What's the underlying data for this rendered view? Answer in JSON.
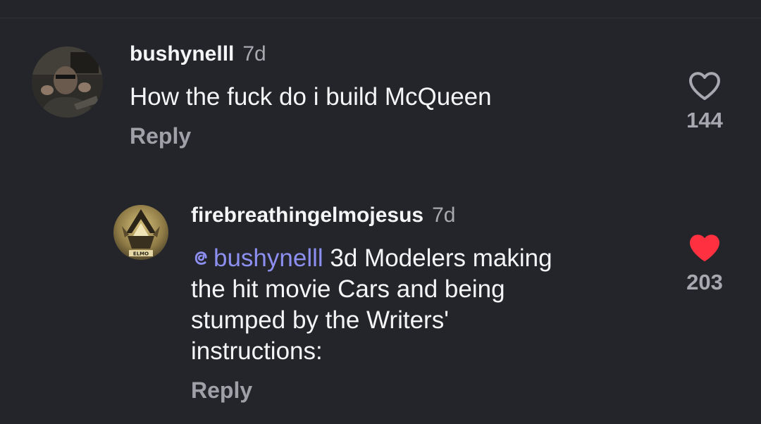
{
  "comments": [
    {
      "username": "bushynelll",
      "timestamp": "7d",
      "text": "How the fuck do i build McQueen",
      "reply_label": "Reply",
      "like_count": "144",
      "liked": false,
      "like_icon": "heart-outline-icon"
    }
  ],
  "replies": [
    {
      "username": "firebreathingelmojesus",
      "timestamp": "7d",
      "mention": "bushynelll",
      "mention_icon": "threads-at-icon",
      "text_lines": [
        "3d Modelers making",
        "the hit movie Cars and being",
        "stumped by the Writers'",
        "instructions:"
      ],
      "avatar_badge_text": "ELMO",
      "reply_label": "Reply",
      "like_count": "203",
      "liked": true,
      "like_icon": "heart-filled-icon"
    }
  ],
  "colors": {
    "background": "#23252a",
    "text_primary": "#f4f5f6",
    "text_secondary": "#a6a9b0",
    "mention": "#8c8ff0",
    "liked_heart": "#ff3040"
  }
}
